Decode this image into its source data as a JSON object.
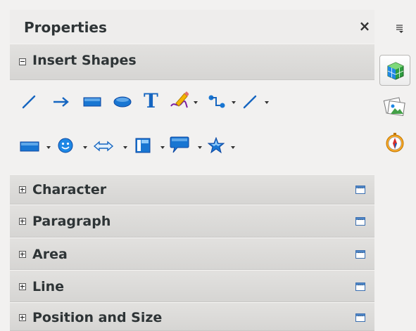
{
  "panel": {
    "title": "Properties",
    "close_label": "×"
  },
  "sections": {
    "insert_shapes": {
      "label": "Insert Shapes",
      "expanded": true
    },
    "character": {
      "label": "Character"
    },
    "paragraph": {
      "label": "Paragraph"
    },
    "area": {
      "label": "Area"
    },
    "line": {
      "label": "Line"
    },
    "position_size": {
      "label": "Position and Size"
    }
  },
  "tools": {
    "row1": [
      "line-icon",
      "arrow-icon",
      "rectangle-icon",
      "ellipse-icon",
      "text-icon",
      "freeform-line-icon",
      "connector-icon",
      "lines-arrows-icon"
    ],
    "row2": [
      "basic-shapes-icon",
      "symbol-shapes-icon",
      "block-arrows-icon",
      "flowchart-icon",
      "callout-icon",
      "stars-icon"
    ],
    "text_glyph": "T"
  },
  "deck": {
    "tabs": [
      "properties-tab-icon",
      "gallery-tab-icon",
      "navigator-tab-icon"
    ],
    "active": "properties-tab-icon"
  },
  "colors": {
    "accent_blue": "#1565c0",
    "panel_bg": "#f2f1f0",
    "section_bg": "#dcdbd9"
  }
}
